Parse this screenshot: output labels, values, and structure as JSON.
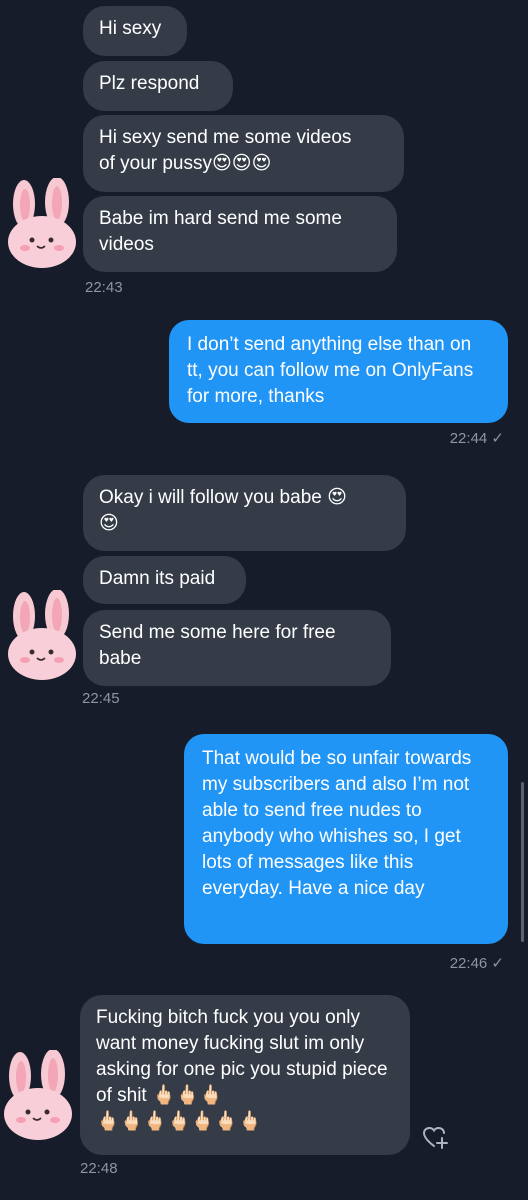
{
  "messages": {
    "m1": "Hi sexy",
    "m2": "Plz respond",
    "m3_line1": "Hi sexy send me some videos",
    "m3_line2": "of your pussy",
    "m3_emoji": "😍😍😍",
    "m4": "Babe im hard send me some videos",
    "t1": "22:43",
    "o1": "I don’t send anything else than on tt, you can follow me on OnlyFans for more, thanks",
    "t2": "22:44 ✓",
    "m5": "Okay i will follow you babe",
    "m5_emoji_a": "😍",
    "m5_emoji_b": "😍",
    "m6": "Damn its paid",
    "m7": "Send me some here for free babe",
    "t3": "22:45",
    "o2": "That would be so unfair towards my subscribers and also I’m not able to send free nudes to anybody who whishes so, I get lots of messages like this everyday. Have a nice day",
    "t4": "22:46 ✓",
    "m8_text": "Fucking bitch fuck you you only want money fucking slut im only asking for one pic you stupid piece of shit",
    "m8_emoji_inline": "🖕🏻🖕🏻🖕🏻",
    "m8_emoji_line": "🖕🏻🖕🏻🖕🏻🖕🏻🖕🏻🖕🏻🖕🏻",
    "t5": "22:48"
  },
  "colors": {
    "background": "#161c2a",
    "incoming_bubble": "#353c48",
    "outgoing_bubble": "#2195f5",
    "timestamp": "#8e95a0"
  },
  "icons": {
    "avatar": "pink-bunny-icon",
    "reaction": "heart-add-icon"
  }
}
